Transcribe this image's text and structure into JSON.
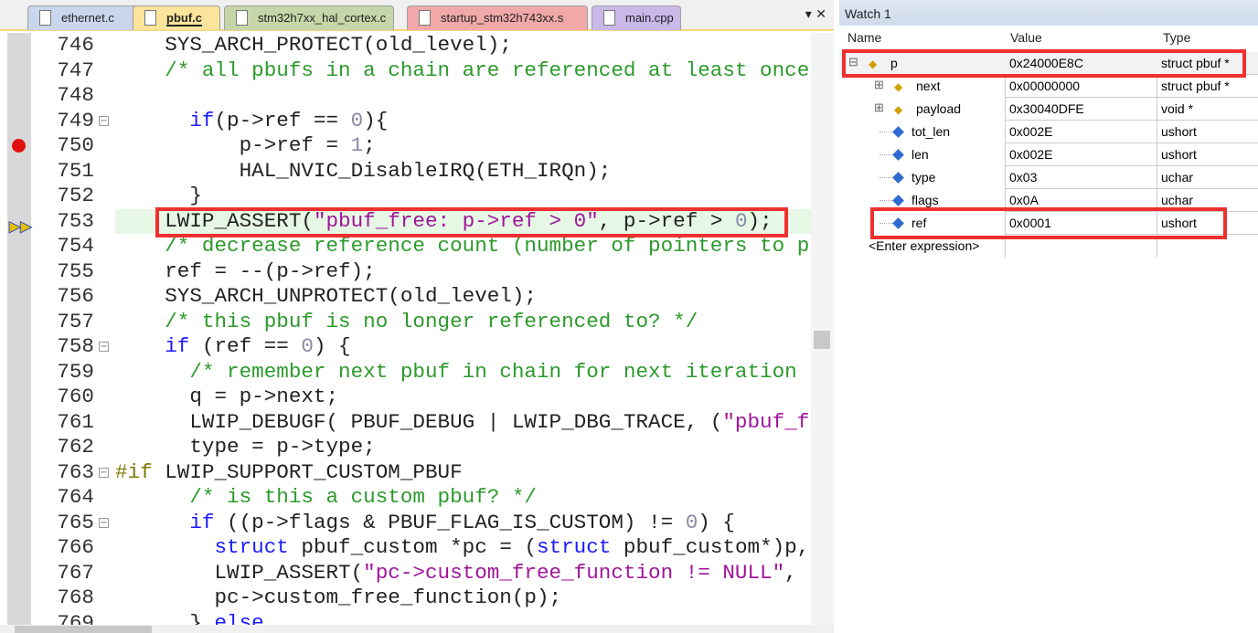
{
  "tabs": [
    {
      "label": "ethernet.c",
      "color": "#c9d6ee",
      "active": false
    },
    {
      "label": "pbuf.c",
      "color": "#fce59a",
      "active": true
    },
    {
      "label": "stm32h7xx_hal_cortex.c",
      "color": "#c6d6a8",
      "active": false
    },
    {
      "label": "startup_stm32h743xx.s",
      "color": "#f0a8a8",
      "active": false
    },
    {
      "label": "main.cpp",
      "color": "#c9b8e8",
      "active": false
    }
  ],
  "tab_controls": "▾ ✕",
  "editor": {
    "breakpoint_line": 750,
    "current_line": 753,
    "lines": [
      {
        "n": "746",
        "t": [
          [
            "",
            "    SYS_ARCH_PROTECT(old_level);"
          ]
        ]
      },
      {
        "n": "747",
        "t": [
          [
            "cm",
            "    /* all pbufs in a chain are referenced at least once"
          ]
        ]
      },
      {
        "n": "748",
        "t": []
      },
      {
        "n": "749",
        "fold": true,
        "t": [
          [
            "",
            "      "
          ],
          [
            "kw",
            "if"
          ],
          [
            "",
            "(p->ref == "
          ],
          [
            "num",
            "0"
          ],
          [
            "",
            "){"
          ]
        ]
      },
      {
        "n": "750",
        "t": [
          [
            "",
            "          p->ref = "
          ],
          [
            "num",
            "1"
          ],
          [
            "",
            ";"
          ]
        ]
      },
      {
        "n": "751",
        "t": [
          [
            "",
            "          HAL_NVIC_DisableIRQ(ETH_IRQn);"
          ]
        ]
      },
      {
        "n": "752",
        "t": [
          [
            "",
            "      }"
          ]
        ]
      },
      {
        "n": "753",
        "t": [
          [
            "",
            "    LWIP_ASSERT("
          ],
          [
            "str",
            "\"pbuf_free: p->ref > 0\""
          ],
          [
            "",
            ", p->ref > "
          ],
          [
            "num",
            "0"
          ],
          [
            "",
            ");"
          ]
        ]
      },
      {
        "n": "754",
        "t": [
          [
            "cm",
            "    /* decrease reference count (number of pointers to p"
          ]
        ]
      },
      {
        "n": "755",
        "t": [
          [
            "",
            "    ref = --(p->ref);"
          ]
        ]
      },
      {
        "n": "756",
        "t": [
          [
            "",
            "    SYS_ARCH_UNPROTECT(old_level);"
          ]
        ]
      },
      {
        "n": "757",
        "t": [
          [
            "cm",
            "    /* this pbuf is no longer referenced to? */"
          ]
        ]
      },
      {
        "n": "758",
        "fold": true,
        "t": [
          [
            "",
            "    "
          ],
          [
            "kw",
            "if"
          ],
          [
            "",
            " (ref == "
          ],
          [
            "num",
            "0"
          ],
          [
            "",
            ") {"
          ]
        ]
      },
      {
        "n": "759",
        "t": [
          [
            "cm",
            "      /* remember next pbuf in chain for next iteration"
          ]
        ]
      },
      {
        "n": "760",
        "t": [
          [
            "",
            "      q = p->next;"
          ]
        ]
      },
      {
        "n": "761",
        "t": [
          [
            "",
            "      LWIP_DEBUGF( PBUF_DEBUG | LWIP_DBG_TRACE, ("
          ],
          [
            "str",
            "\"pbuf_f"
          ]
        ]
      },
      {
        "n": "762",
        "t": [
          [
            "",
            "      type = p->type;"
          ]
        ]
      },
      {
        "n": "763",
        "fold": true,
        "t": [
          [
            "pp",
            "#if"
          ],
          [
            "",
            " LWIP_SUPPORT_CUSTOM_PBUF"
          ]
        ]
      },
      {
        "n": "764",
        "t": [
          [
            "cm",
            "      /* is this a custom pbuf? */"
          ]
        ]
      },
      {
        "n": "765",
        "fold": true,
        "t": [
          [
            "",
            "      "
          ],
          [
            "kw",
            "if"
          ],
          [
            "",
            " ((p->flags & PBUF_FLAG_IS_CUSTOM) != "
          ],
          [
            "num",
            "0"
          ],
          [
            "",
            ") {"
          ]
        ]
      },
      {
        "n": "766",
        "t": [
          [
            "",
            "        "
          ],
          [
            "kw",
            "struct"
          ],
          [
            "",
            " pbuf_custom *pc = ("
          ],
          [
            "kw",
            "struct"
          ],
          [
            "",
            " pbuf_custom*)p,"
          ]
        ]
      },
      {
        "n": "767",
        "t": [
          [
            "",
            "        LWIP_ASSERT("
          ],
          [
            "str",
            "\"pc->custom_free_function != NULL\""
          ],
          [
            "",
            ","
          ]
        ]
      },
      {
        "n": "768",
        "t": [
          [
            "",
            "        pc->custom_free_function(p);"
          ]
        ]
      },
      {
        "n": "769",
        "t": [
          [
            "",
            "      } "
          ],
          [
            "kw",
            "else"
          ]
        ]
      }
    ]
  },
  "watch": {
    "title": "Watch 1",
    "columns": {
      "name": "Name",
      "value": "Value",
      "type": "Type"
    },
    "rows": [
      {
        "name": "p",
        "value": "0x24000E8C",
        "type": "struct pbuf *",
        "expander": "⊟",
        "icon": "struct-icon",
        "level": 0
      },
      {
        "name": "next",
        "value": "0x00000000",
        "type": "struct pbuf *",
        "expander": "⊞",
        "icon": "struct-icon",
        "level": 1
      },
      {
        "name": "payload",
        "value": "0x30040DFE",
        "type": "void *",
        "expander": "⊞",
        "icon": "struct-icon",
        "level": 1
      },
      {
        "name": "tot_len",
        "value": "0x002E",
        "type": "ushort",
        "icon": "field-icon",
        "level": 1
      },
      {
        "name": "len",
        "value": "0x002E",
        "type": "ushort",
        "icon": "field-icon",
        "level": 1
      },
      {
        "name": "type",
        "value": "0x03",
        "type": "uchar",
        "icon": "field-icon",
        "level": 1
      },
      {
        "name": "flags",
        "value": "0x0A",
        "type": "uchar",
        "icon": "field-icon",
        "level": 1
      },
      {
        "name": "ref",
        "value": "0x0001",
        "type": "ushort",
        "icon": "field-icon",
        "level": 1
      }
    ],
    "enter_expression": "<Enter expression>"
  },
  "highlight_color": "#f03030"
}
